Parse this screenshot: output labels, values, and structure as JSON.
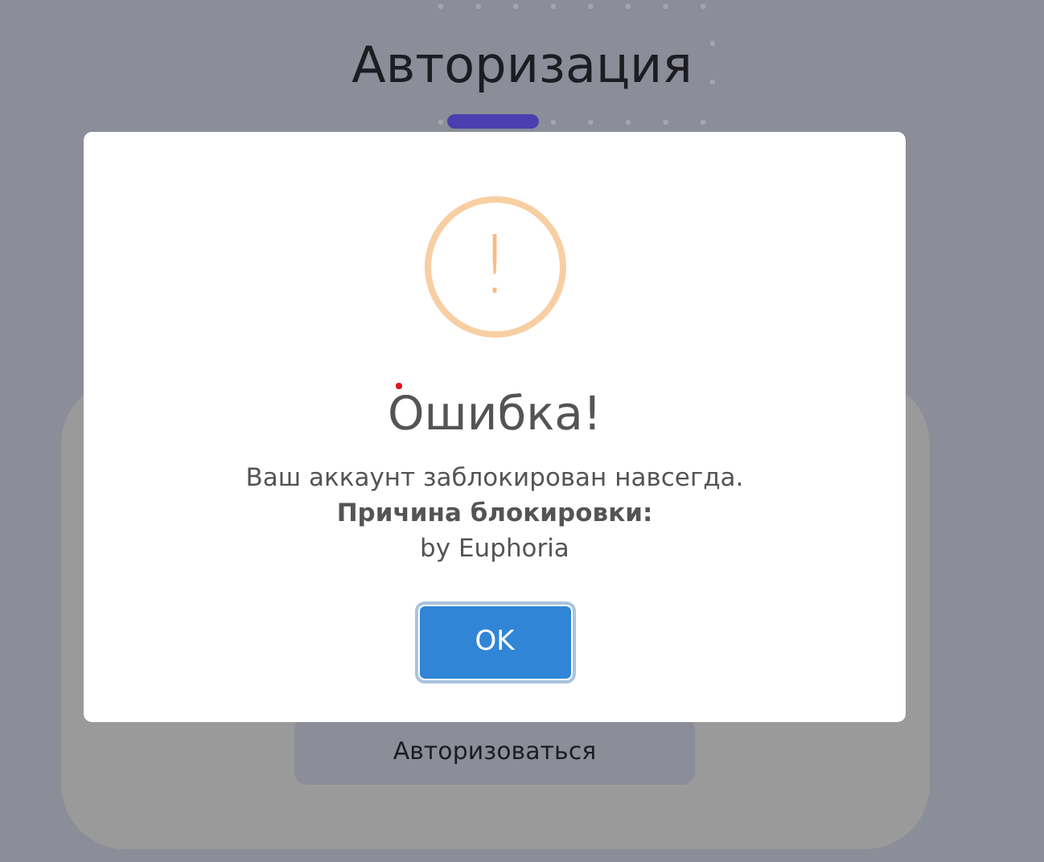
{
  "page": {
    "title": "Авторизация"
  },
  "login_button": {
    "label": "Авторизоваться"
  },
  "dialog": {
    "icon": "!",
    "title": "Ошибка!",
    "message": "Ваш аккаунт заблокирован навсегда.",
    "reason_label": "Причина блокировки:",
    "reason": "by Euphoria",
    "buttons": [
      {
        "label": "OK"
      }
    ]
  }
}
